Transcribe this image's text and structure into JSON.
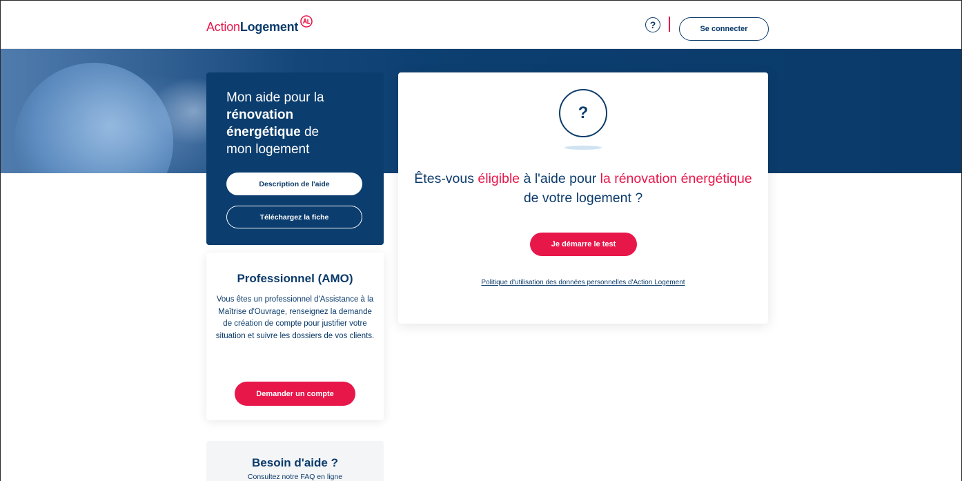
{
  "header": {
    "logo_action": "Action",
    "logo_logement": "Logement",
    "help_icon_glyph": "?",
    "login_label": "Se connecter"
  },
  "aid_card": {
    "title_1": "Mon aide pour la",
    "title_2": "rénovation",
    "title_3": "énergétique",
    "title_4": " de",
    "title_5": "mon logement",
    "description_label": "Description de l'aide",
    "download_label": "Téléchargez la fiche"
  },
  "pro_card": {
    "title": "Professionnel (AMO)",
    "text": "Vous êtes un professionnel d'Assistance à la Maîtrise d'Ouvrage, renseignez la demande de création de compte pour justifier votre situation et suivre les dossiers de vos clients.",
    "button_label": "Demander un compte"
  },
  "help_card": {
    "title": "Besoin d'aide ?",
    "subtitle": "Consultez notre FAQ en ligne"
  },
  "main_card": {
    "question_glyph": "?",
    "title_part1": "Êtes-vous ",
    "title_hl1": "éligible",
    "title_part2": " à l'aide pour ",
    "title_hl2": "la rénovation énergétique",
    "title_part3": " de votre logement ?",
    "start_label": "Je démarre le test",
    "policy_label": "Politique d'utilisation des données personnelles d'Action Logement"
  },
  "colors": {
    "brand_red": "#e8174a",
    "brand_navy": "#0b3b6b"
  }
}
